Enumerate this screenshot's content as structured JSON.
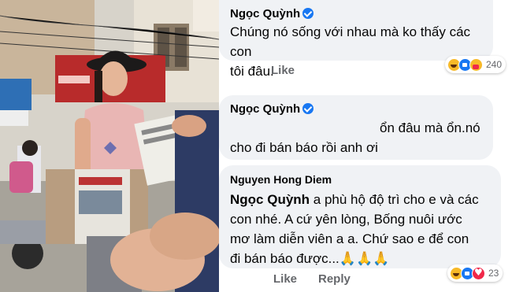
{
  "comments": [
    {
      "author": "Ngọc Quỳnh",
      "verified": true,
      "lines": [
        "Chúng nó sống với nhau mà ko thấy các con",
        "tôi đâu."
      ],
      "like_label": "Like",
      "reactions": {
        "icons": [
          "haha-icon",
          "like-icon",
          "care-icon"
        ],
        "count": "240"
      }
    },
    {
      "author": "Ngọc Quỳnh",
      "verified": true,
      "lines": [
        "ổn đâu mà ổn.nó",
        "cho đi bán báo rồi anh ơi"
      ]
    },
    {
      "author": "Nguyen Hong Diem",
      "verified": false,
      "mention": "Ngọc Quỳnh",
      "lines": [
        " a phù hộ độ trì cho e và các",
        "con nhé. A cứ yên lòng, Bống nuôi ước",
        "mơ làm diễn viên a a. Chứ sao e để con",
        "đi bán báo được...🙏🙏🙏"
      ],
      "like_label": "Like",
      "reply_label": "Reply",
      "reactions": {
        "icons": [
          "haha-icon",
          "like-icon",
          "love-icon"
        ],
        "count": "23"
      }
    }
  ],
  "colors": {
    "bubble": "#f0f2f5",
    "verified": "#1877f2",
    "action_text": "#65676b"
  }
}
